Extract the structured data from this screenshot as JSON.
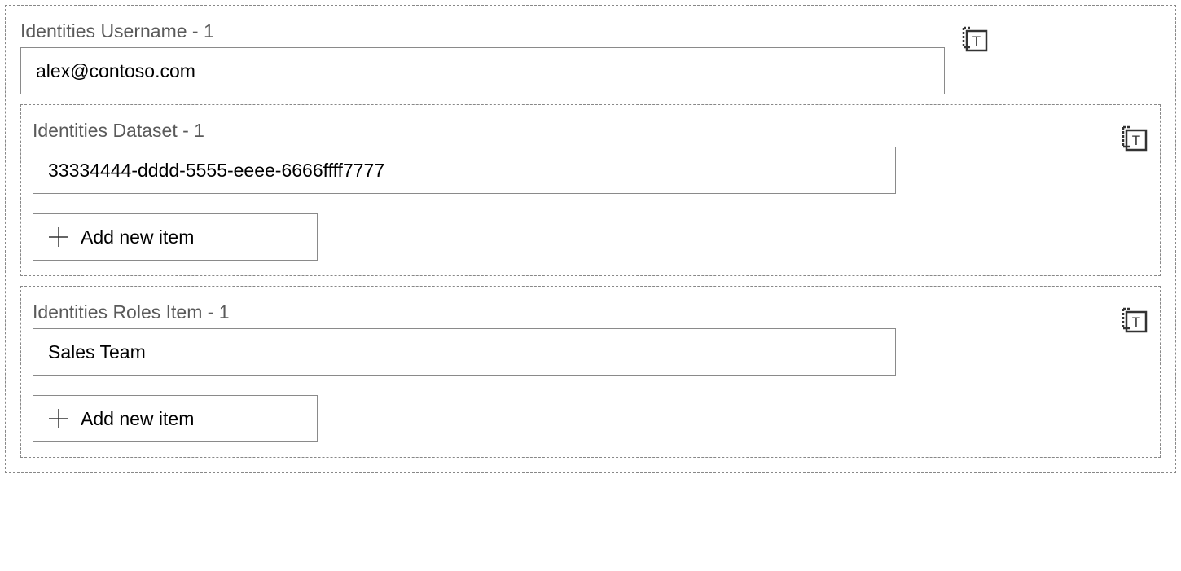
{
  "username": {
    "label": "Identities Username - 1",
    "value": "alex@contoso.com"
  },
  "dataset": {
    "label": "Identities Dataset - 1",
    "value": "33334444-dddd-5555-eeee-6666ffff7777",
    "add_label": "Add new item"
  },
  "roles": {
    "label": "Identities Roles Item - 1",
    "value": "Sales Team",
    "add_label": "Add new item"
  }
}
